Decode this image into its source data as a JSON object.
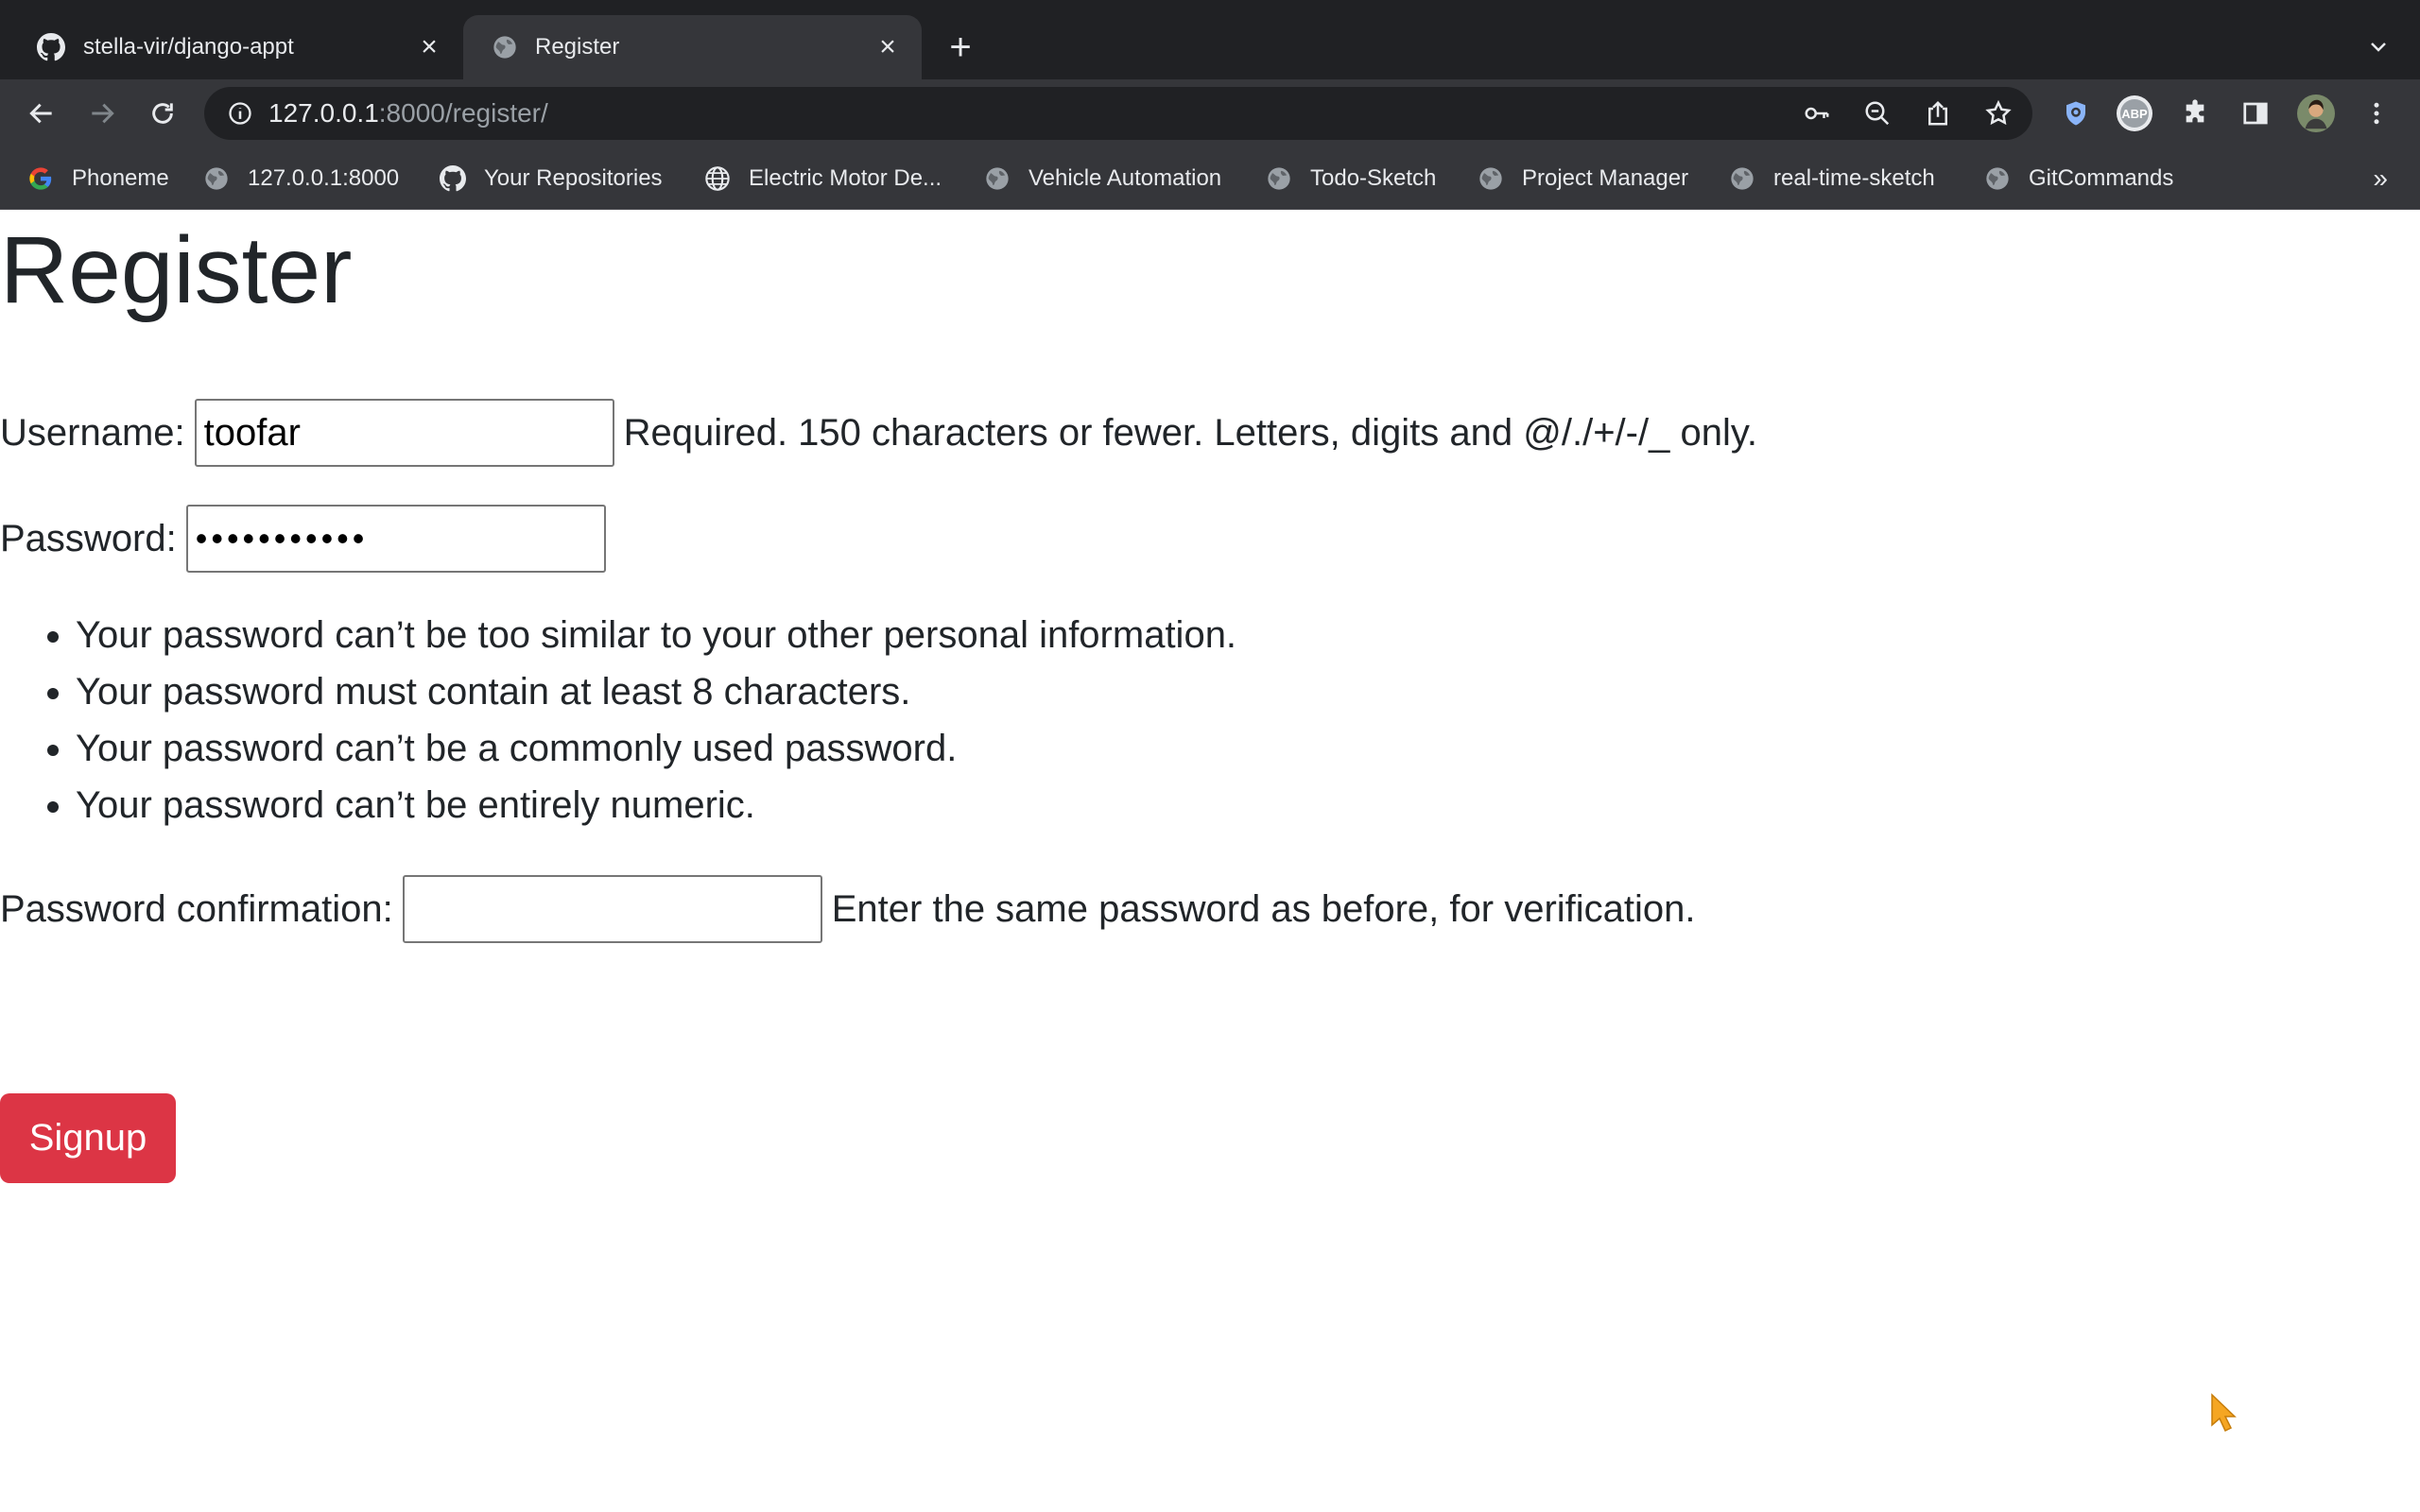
{
  "browser": {
    "tabs": [
      {
        "title": "stella-vir/django-appt",
        "icon": "github-icon",
        "active": false
      },
      {
        "title": "Register",
        "icon": "globe-icon",
        "active": true
      }
    ],
    "address": {
      "host": "127.0.0.1",
      "rest": ":8000/register/"
    },
    "bookmarks": [
      {
        "label": "Phoneme",
        "icon": "google-icon"
      },
      {
        "label": "127.0.0.1:8000",
        "icon": "globe-icon"
      },
      {
        "label": "Your Repositories",
        "icon": "github-icon"
      },
      {
        "label": "Electric Motor De...",
        "icon": "world-icon"
      },
      {
        "label": "Vehicle Automation",
        "icon": "globe-icon"
      },
      {
        "label": "Todo-Sketch",
        "icon": "globe-icon"
      },
      {
        "label": "Project Manager",
        "icon": "globe-icon"
      },
      {
        "label": "real-time-sketch",
        "icon": "globe-icon"
      },
      {
        "label": "GitCommands",
        "icon": "globe-icon"
      }
    ],
    "bookmarks_overflow": "»",
    "extensions": {
      "abp_label": "ABP"
    }
  },
  "page": {
    "heading": "Register",
    "username": {
      "label": "Username:",
      "value": "toofar",
      "help": "Required. 150 characters or fewer. Letters, digits and @/./+/-/_ only."
    },
    "password": {
      "label": "Password:",
      "masked": "•••••••••••"
    },
    "password_rules": [
      "Your password can’t be too similar to your other personal information.",
      "Your password must contain at least 8 characters.",
      "Your password can’t be a commonly used password.",
      "Your password can’t be entirely numeric."
    ],
    "password_confirmation": {
      "label": "Password confirmation:",
      "value": "",
      "help": "Enter the same password as before, for verification."
    },
    "submit_label": "Signup"
  },
  "colors": {
    "signup_button": "#dc3545",
    "chrome_dark": "#202124",
    "chrome_toolbar": "#35363a",
    "cursor": "#f5a623"
  }
}
